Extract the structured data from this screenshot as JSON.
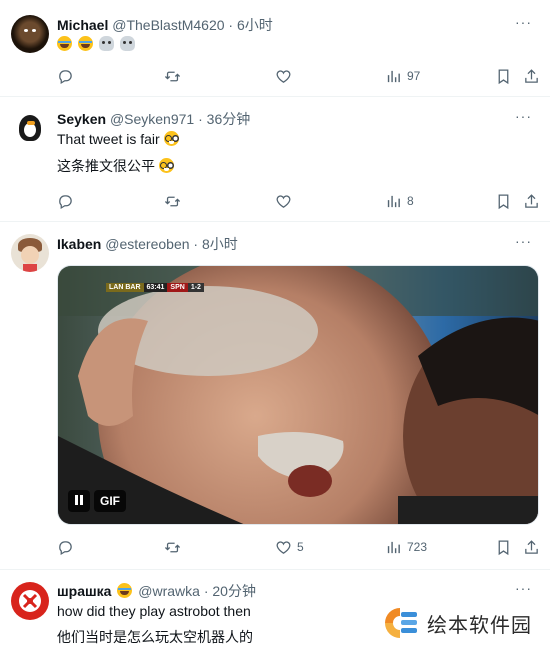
{
  "tweets": [
    {
      "name": "Michael",
      "handle": "@TheBlastM4620",
      "time": "6小时",
      "views": "97",
      "emoji_icons": [
        "laughing-crying-emoji",
        "laughing-crying-emoji",
        "skull-emoji",
        "skull-emoji"
      ]
    },
    {
      "name": "Seyken",
      "handle": "@Seyken971",
      "time": "36分钟",
      "text_en": "That tweet is fair",
      "text_zh": "这条推文很公平",
      "views": "8",
      "emoji_icons": [
        "nerd-face-emoji"
      ]
    },
    {
      "name": "Ikaben",
      "handle": "@estereoben",
      "time": "8小时",
      "likes": "5",
      "views": "723",
      "media": {
        "type": "gif",
        "gif_label": "GIF",
        "scorebar": [
          "LAN BAR",
          "63:41",
          "SPN",
          "1-2"
        ]
      }
    },
    {
      "name": "шрашка",
      "handle": "@wrawka",
      "time": "20分钟",
      "text_en": "how did they play astrobot then",
      "text_zh": "他们当时是怎么玩太空机器人的",
      "emoji_icons": [
        "slightly-smiling-emoji"
      ]
    }
  ],
  "separator": "·",
  "more_label": "···",
  "watermark": {
    "text": "绘本软件园",
    "icon": "watermark-logo-icon"
  },
  "colors": {
    "text": "#0f1419",
    "secondary": "#536471",
    "border": "#eff3f4"
  }
}
